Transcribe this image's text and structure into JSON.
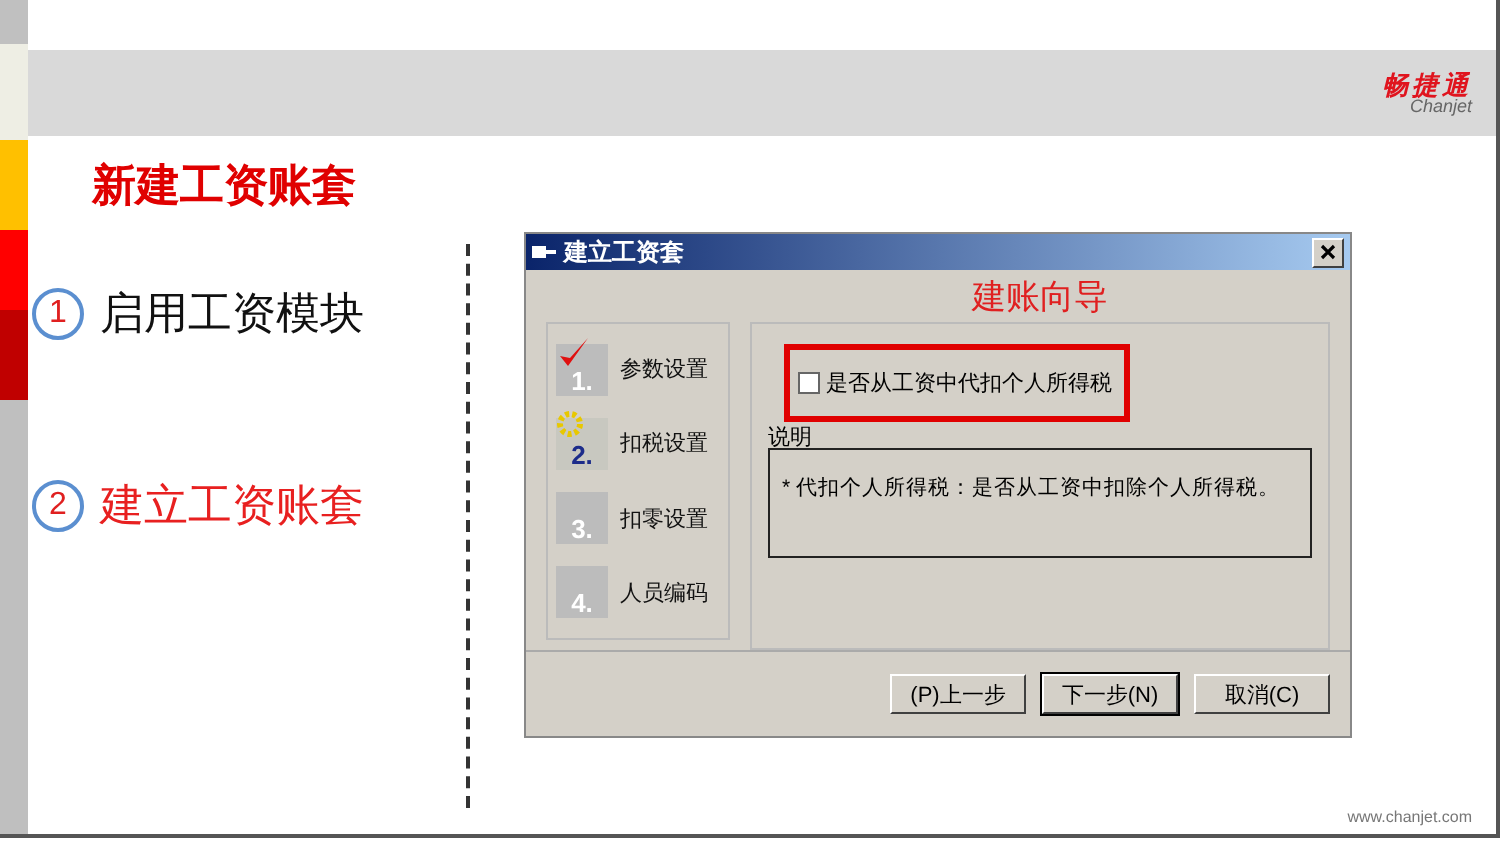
{
  "header": {
    "logo_name": "畅捷通",
    "logo_latin": "Chanjet"
  },
  "title": "新建工资账套",
  "steps": [
    {
      "number": "1",
      "label": "启用工资模块",
      "selected": false
    },
    {
      "number": "2",
      "label": "建立工资账套",
      "selected": true
    }
  ],
  "dialog": {
    "title": "建立工资套",
    "wizard_steps": [
      {
        "number": "1.",
        "label": "参数设置",
        "kind": "done"
      },
      {
        "number": "2.",
        "label": "扣税设置",
        "kind": "current"
      },
      {
        "number": "3.",
        "label": "扣零设置",
        "kind": "pending"
      },
      {
        "number": "4.",
        "label": "人员编码",
        "kind": "pending"
      }
    ],
    "heading": "建账向导",
    "option": {
      "label": "是否从工资中代扣个人所得税",
      "checked": false
    },
    "note": {
      "legend": "说明",
      "text": "* 代扣个人所得税：是否从工资中扣除个人所得税。"
    },
    "buttons": [
      {
        "label": "(P)上一步",
        "default": false
      },
      {
        "label": "下一步(N)",
        "default": true
      },
      {
        "label": "取消(C)",
        "default": false
      }
    ]
  },
  "footer": "www.chanjet.com"
}
